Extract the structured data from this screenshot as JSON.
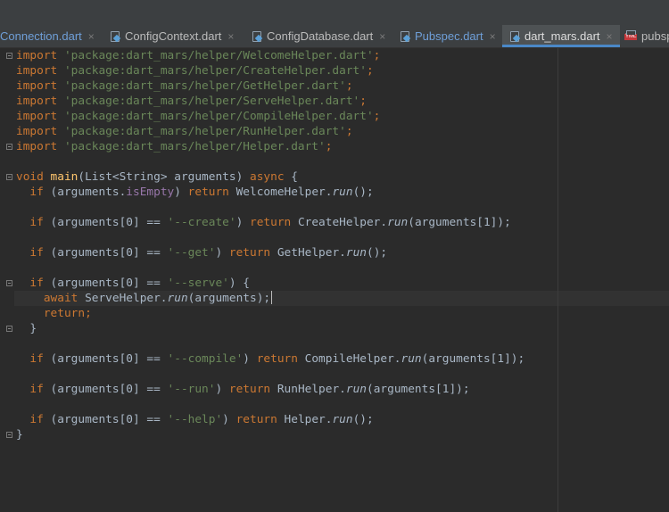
{
  "tabs": [
    {
      "label": "Connection.dart",
      "icon": "dart-file-icon",
      "style": "blue"
    },
    {
      "label": "ConfigContext.dart",
      "icon": "dart-file-icon",
      "style": "normal"
    },
    {
      "label": "ConfigDatabase.dart",
      "icon": "dart-file-icon",
      "style": "normal"
    },
    {
      "label": "Pubspec.dart",
      "icon": "dart-file-icon",
      "style": "blue"
    },
    {
      "label": "dart_mars.dart",
      "icon": "dart-file-icon",
      "style": "active"
    },
    {
      "label": "pubsp",
      "icon": "yml-file-icon",
      "style": "normal"
    }
  ],
  "close_glyph": "×",
  "code": {
    "imports": [
      {
        "kw": "import",
        "path": "'package:dart_mars/helper/WelcomeHelper.dart'",
        "end": ";"
      },
      {
        "kw": "import",
        "path": "'package:dart_mars/helper/CreateHelper.dart'",
        "end": ";"
      },
      {
        "kw": "import",
        "path": "'package:dart_mars/helper/GetHelper.dart'",
        "end": ";"
      },
      {
        "kw": "import",
        "path": "'package:dart_mars/helper/ServeHelper.dart'",
        "end": ";"
      },
      {
        "kw": "import",
        "path": "'package:dart_mars/helper/CompileHelper.dart'",
        "end": ";"
      },
      {
        "kw": "import",
        "path": "'package:dart_mars/helper/RunHelper.dart'",
        "end": ";"
      },
      {
        "kw": "import",
        "path": "'package:dart_mars/helper/Helper.dart'",
        "end": ";"
      }
    ],
    "main_decl": {
      "void": "void",
      "name": "main",
      "params": "(List<String> arguments) ",
      "async": "async",
      "brace": " {"
    },
    "welcome": {
      "if": "if",
      "cond_a": " (arguments.",
      "prop": "isEmpty",
      "cond_b": ") ",
      "ret": "return",
      "helper": " WelcomeHelper.",
      "run": "run",
      "tail": "();"
    },
    "create": {
      "if": "if",
      "cond": " (arguments[0] == ",
      "str": "'--create'",
      "close": ") ",
      "ret": "return",
      "helper": " CreateHelper.",
      "run": "run",
      "tail": "(arguments[1]);"
    },
    "get": {
      "if": "if",
      "cond": " (arguments[0] == ",
      "str": "'--get'",
      "close": ") ",
      "ret": "return",
      "helper": " GetHelper.",
      "run": "run",
      "tail": "();"
    },
    "serve": {
      "if": "if",
      "cond": " (arguments[0] == ",
      "str": "'--serve'",
      "close": ") {",
      "await": "await",
      "helper": " ServeHelper.",
      "run": "run",
      "tail": "(arguments);",
      "ret": "return",
      "semi": ";",
      "close_brace": "}"
    },
    "compile": {
      "if": "if",
      "cond": " (arguments[0] == ",
      "str": "'--compile'",
      "close": ") ",
      "ret": "return",
      "helper": " CompileHelper.",
      "run": "run",
      "tail": "(arguments[1]);"
    },
    "runopt": {
      "if": "if",
      "cond": " (arguments[0] == ",
      "str": "'--run'",
      "close": ") ",
      "ret": "return",
      "helper": " RunHelper.",
      "run": "run",
      "tail": "(arguments[1]);"
    },
    "help": {
      "if": "if",
      "cond": " (arguments[0] == ",
      "str": "'--help'",
      "close": ") ",
      "ret": "return",
      "helper": " Helper.",
      "run": "run",
      "tail": "();"
    },
    "end_brace": "}"
  },
  "colors": {
    "keyword": "#cc7832",
    "string": "#6a8759",
    "function": "#ffc66d",
    "text": "#a9b7c6",
    "accent": "#4a88c7"
  }
}
